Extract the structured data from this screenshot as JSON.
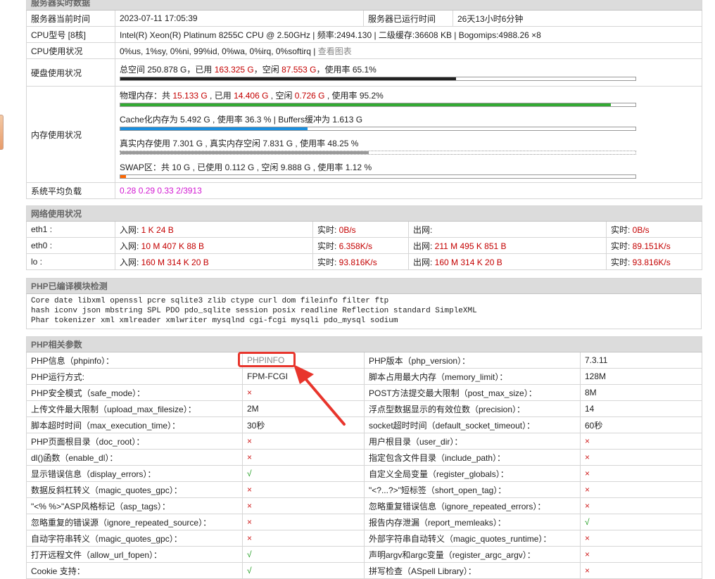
{
  "server": {
    "section_title": "服务器实时数据",
    "time_label": "服务器当前时间",
    "time_value": "2023-07-11 17:05:39",
    "uptime_label": "服务器已运行时间",
    "uptime_value": "26天13小时6分钟",
    "cpu_model_label": "CPU型号 [8核]",
    "cpu_model_value": "Intel(R) Xeon(R) Platinum 8255C CPU @ 2.50GHz | 频率:2494.130 | 二级缓存:36608 KB | Bogomips:4988.26 ×8",
    "cpu_usage_label": "CPU使用状况",
    "cpu_usage_value": "0%us, 1%sy, 0%ni, 99%id, 0%wa, 0%irq, 0%softirq",
    "cpu_usage_sep": " | ",
    "cpu_chart_link": "查看图表",
    "disk_label": "硬盘使用状况",
    "disk_total_prefix": "总空间 250.878 G，已用 ",
    "disk_used": "163.325 G",
    "disk_mid": "，空闲 ",
    "disk_free": "87.553 G",
    "disk_suffix": "，使用率 65.1%",
    "disk_percent": 65.1,
    "mem_label": "内存使用状况",
    "mem_phys_prefix": "物理内存：共 ",
    "mem_phys_total": "15.133 G",
    "mem_phys_used_prefix": " , 已用 ",
    "mem_phys_used": "14.406 G",
    "mem_phys_free_prefix": " , 空闲 ",
    "mem_phys_free": "0.726 G",
    "mem_phys_suffix": " , 使用率 95.2%",
    "mem_phys_percent": 95.2,
    "mem_cache_text": "Cache化内存为 5.492 G , 使用率 36.3 % | Buffers缓冲为 1.613 G",
    "mem_cache_percent": 36.3,
    "mem_real_text": "真实内存使用 7.301 G , 真实内存空闲 7.831 G , 使用率 48.25 %",
    "mem_real_percent": 48.25,
    "mem_swap_text": "SWAP区：共 10 G , 已使用 0.112 G , 空闲 9.888 G , 使用率 1.12 %",
    "mem_swap_percent": 1.12,
    "load_label": "系统平均负载",
    "load_value": "0.28 0.29 0.33 2/3913"
  },
  "network": {
    "section_title": "网络使用状况",
    "rows": [
      {
        "iface": "eth1 :",
        "in_label": "入网: ",
        "in": "1 K 24 B",
        "rt_label": "实时: ",
        "rt_in": "0B/s",
        "out_label": "出网: ",
        "out": "",
        "rt2_label": "实时: ",
        "rt_out": "0B/s"
      },
      {
        "iface": "eth0 :",
        "in_label": "入网: ",
        "in": "10 M 407 K 88 B",
        "rt_label": "实时: ",
        "rt_in": "6.358K/s",
        "out_label": "出网: ",
        "out": "211 M 495 K 851 B",
        "rt2_label": "实时: ",
        "rt_out": "89.151K/s"
      },
      {
        "iface": "lo :",
        "in_label": "入网: ",
        "in": "160 M 314 K 20 B",
        "rt_label": "实时: ",
        "rt_in": "93.816K/s",
        "out_label": "出网: ",
        "out": "160 M 314 K 20 B",
        "rt2_label": "实时: ",
        "rt_out": "93.816K/s"
      }
    ]
  },
  "modules": {
    "section_title": "PHP已编译模块检测",
    "line1": "Core  date  libxml  openssl  pcre  sqlite3  zlib  ctype  curl  dom  fileinfo  filter  ftp",
    "line2": "hash  iconv  json  mbstring  SPL  PDO  pdo_sqlite  session  posix  readline  Reflection  standard  SimpleXML",
    "line3": "Phar  tokenizer  xml  xmlreader  xmlwriter  mysqlnd  cgi-fcgi  mysqli  pdo_mysql  sodium"
  },
  "php": {
    "section_title": "PHP相关参数",
    "rows": [
      {
        "l": "PHP信息（phpinfo）：",
        "lv": "PHPINFO",
        "lt": "link",
        "r": "PHP版本（php_version）：",
        "rv": "7.3.11",
        "rt": "text"
      },
      {
        "l": "PHP运行方式:",
        "lv": "FPM-FCGI",
        "lt": "text",
        "r": "脚本占用最大内存（memory_limit）：",
        "rv": "128M",
        "rt": "text"
      },
      {
        "l": "PHP安全模式（safe_mode）：",
        "lv": "×",
        "lt": "x",
        "r": "POST方法提交最大限制（post_max_size）：",
        "rv": "8M",
        "rt": "text"
      },
      {
        "l": "上传文件最大限制（upload_max_filesize）：",
        "lv": "2M",
        "lt": "text",
        "r": "浮点型数据显示的有效位数（precision）：",
        "rv": "14",
        "rt": "text"
      },
      {
        "l": "脚本超时时间（max_execution_time）：",
        "lv": "30秒",
        "lt": "text",
        "r": "socket超时时间（default_socket_timeout）：",
        "rv": "60秒",
        "rt": "text"
      },
      {
        "l": "PHP页面根目录（doc_root）：",
        "lv": "×",
        "lt": "x",
        "r": "用户根目录（user_dir）：",
        "rv": "×",
        "rt": "x"
      },
      {
        "l": "dl()函数（enable_dl）：",
        "lv": "×",
        "lt": "x",
        "r": "指定包含文件目录（include_path）：",
        "rv": "×",
        "rt": "x"
      },
      {
        "l": "显示错误信息（display_errors）：",
        "lv": "√",
        "lt": "ok",
        "r": "自定义全局变量（register_globals）：",
        "rv": "×",
        "rt": "x"
      },
      {
        "l": "数据反斜杠转义（magic_quotes_gpc）：",
        "lv": "×",
        "lt": "x",
        "r": "\"<?...?>\"短标签（short_open_tag）：",
        "rv": "×",
        "rt": "x"
      },
      {
        "l": "\"<% %>\"ASP风格标记（asp_tags）：",
        "lv": "×",
        "lt": "x",
        "r": "忽略重复错误信息（ignore_repeated_errors）：",
        "rv": "×",
        "rt": "x"
      },
      {
        "l": "忽略重复的错误源（ignore_repeated_source）：",
        "lv": "×",
        "lt": "x",
        "r": "报告内存泄漏（report_memleaks）：",
        "rv": "√",
        "rt": "ok"
      },
      {
        "l": "自动字符串转义（magic_quotes_gpc）：",
        "lv": "×",
        "lt": "x",
        "r": "外部字符串自动转义（magic_quotes_runtime）：",
        "rv": "×",
        "rt": "x"
      },
      {
        "l": "打开远程文件（allow_url_fopen）：",
        "lv": "√",
        "lt": "ok",
        "r": "声明argv和argc变量（register_argc_argv）：",
        "rv": "×",
        "rt": "x"
      },
      {
        "l": "Cookie 支持：",
        "lv": "√",
        "lt": "ok",
        "r": "拼写检查（ASpell Library）：",
        "rv": "×",
        "rt": "x"
      }
    ]
  },
  "colors": {
    "disk_bar": "#222222",
    "mem_bar": "#33aa33",
    "cache_bar": "#1a8fdf",
    "real_bar": "#999999",
    "swap_bar": "#ff6600",
    "annotation": "#e8352c"
  }
}
